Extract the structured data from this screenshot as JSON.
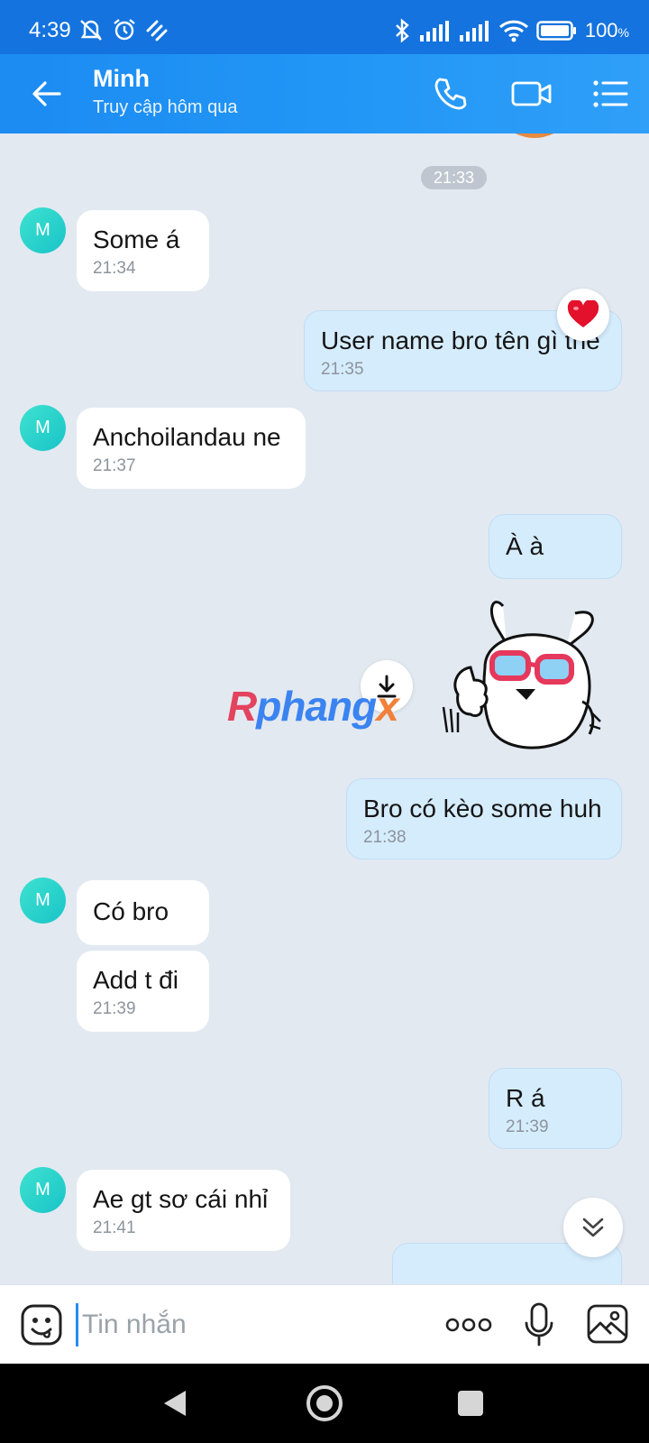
{
  "status_bar": {
    "time": "4:39",
    "battery_value": "100",
    "battery_unit": "%",
    "icons": [
      "mute-icon",
      "alarm-icon",
      "sync-icon",
      "bluetooth-icon",
      "signal-icon",
      "signal-icon",
      "wifi-icon",
      "battery-icon"
    ]
  },
  "header": {
    "name": "Minh",
    "status": "Truy cập hôm qua",
    "icons": [
      "back-arrow-icon",
      "phone-icon",
      "video-call-icon",
      "menu-list-icon"
    ]
  },
  "chat": {
    "time_divider": "21:33",
    "avatar_initial": "M",
    "messages": [
      {
        "dir": "in",
        "text": "Some á",
        "time": "21:34"
      },
      {
        "dir": "out",
        "text": "User name bro tên gì thế",
        "time": "21:35",
        "reaction": "heart-icon"
      },
      {
        "dir": "in",
        "text": "Anchoilandau ne",
        "time": "21:37"
      },
      {
        "dir": "out",
        "text": "À à"
      },
      {
        "dir": "out",
        "type": "sticker",
        "sticker": "rabbit-sunglasses-thumbs-up"
      },
      {
        "dir": "out",
        "text": "Bro có kèo some huh",
        "time": "21:38"
      },
      {
        "dir": "in",
        "text": "Có bro"
      },
      {
        "dir": "in",
        "text": "Add t đi",
        "time": "21:39"
      },
      {
        "dir": "out",
        "text": "R á",
        "time": "21:39"
      },
      {
        "dir": "in",
        "text": "Ae gt sơ cái nhỉ",
        "time": "21:41"
      }
    ],
    "watermark": {
      "part1": "R",
      "part2": "phang",
      "part3": "x"
    }
  },
  "input_bar": {
    "placeholder": "Tin nhắn",
    "icons": [
      "sticker-icon",
      "more-options-icon",
      "microphone-icon",
      "image-icon"
    ]
  },
  "nav_bar": {
    "icons": [
      "back-triangle-icon",
      "home-circle-icon",
      "recents-square-icon"
    ]
  },
  "colors": {
    "header": "#1c8bf2",
    "incoming_bubble": "#ffffff",
    "outgoing_bubble": "#d5ecfd",
    "background": "#e2e9f1",
    "avatar": "#2dd4cb"
  }
}
